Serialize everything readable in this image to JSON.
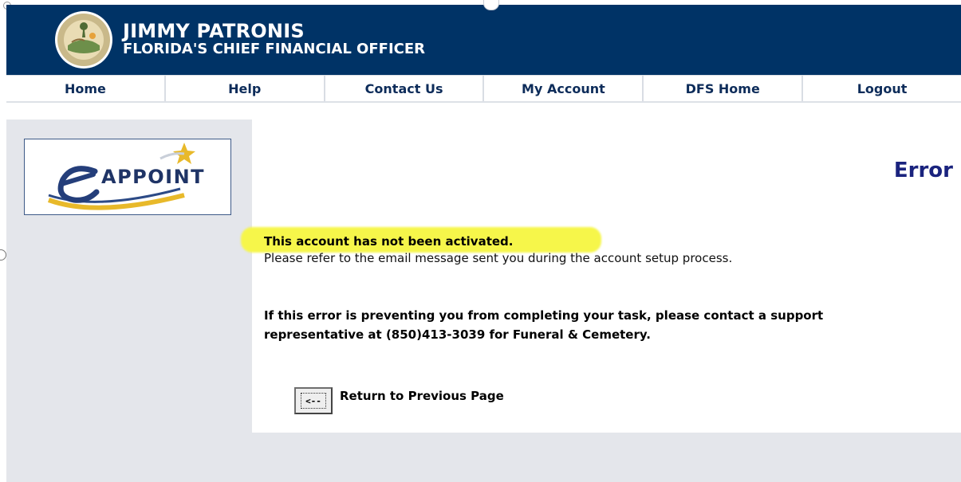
{
  "header": {
    "name": "JIMMY PATRONIS",
    "subtitle": "FLORIDA'S CHIEF FINANCIAL OFFICER",
    "background_color": "#003366",
    "seal_icon": "florida-cfo-seal-icon"
  },
  "nav": {
    "items": [
      {
        "label": "Home"
      },
      {
        "label": "Help"
      },
      {
        "label": "Contact Us"
      },
      {
        "label": "My Account"
      },
      {
        "label": "DFS Home"
      },
      {
        "label": "Logout"
      }
    ]
  },
  "sidebar": {
    "logo_text": "APPOINT",
    "logo_icon": "eappoint-logo-icon"
  },
  "main": {
    "title": "Error",
    "message_bold": "This account has not been activated.",
    "message_text": "Please refer to the email message sent you during the account setup process.",
    "support_line_1": "If this error is preventing you from completing your task, please contact a support",
    "support_line_2": "representative at (850)413-3039 for Funeral & Cemetery.",
    "back_button_glyph": "<--",
    "back_label": "Return to Previous Page",
    "highlight_color": "#f6f64a"
  }
}
